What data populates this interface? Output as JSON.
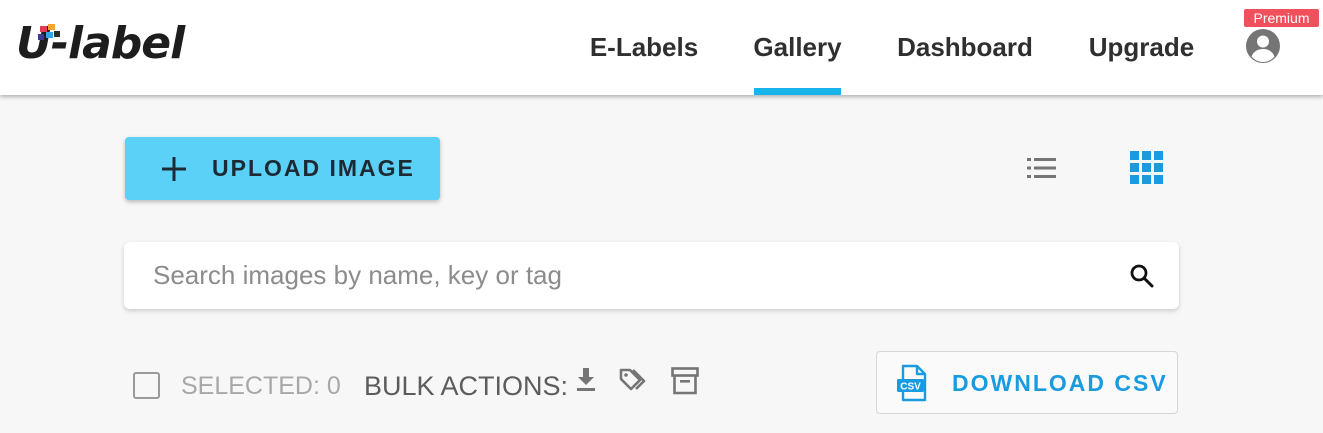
{
  "colors": {
    "accent": "#19b4ec",
    "upload_button_bg": "#5bd1f7",
    "premium_badge": "#f0505b",
    "grid_view_active": "#1a9be0",
    "icon_grey": "#757575",
    "logo_text": "#1d1d1d"
  },
  "brand": {
    "logo_text": "U-label",
    "logo_icon": "colored-squares-logo-icon"
  },
  "nav": {
    "items": [
      {
        "label": "E-Labels",
        "active": false
      },
      {
        "label": "Gallery",
        "active": true
      },
      {
        "label": "Dashboard",
        "active": false
      },
      {
        "label": "Upgrade",
        "active": false
      }
    ],
    "badge": "Premium",
    "account_icon": "account-circle-icon"
  },
  "toolbar": {
    "upload_label": "UPLOAD IMAGE",
    "upload_icon": "plus-icon",
    "list_view_icon": "list-view-icon",
    "grid_view_icon": "grid-view-icon",
    "active_view": "grid"
  },
  "search": {
    "placeholder": "Search images by name, key or tag",
    "value": "",
    "icon": "search-icon"
  },
  "bulk": {
    "selected_label": "SELECTED: 0",
    "bulk_actions_label": "BULK ACTIONS:",
    "actions": [
      "download-icon",
      "tags-icon",
      "archive-icon"
    ]
  },
  "csv": {
    "label": "DOWNLOAD CSV",
    "icon_text": "CSV",
    "icon": "csv-file-icon"
  }
}
